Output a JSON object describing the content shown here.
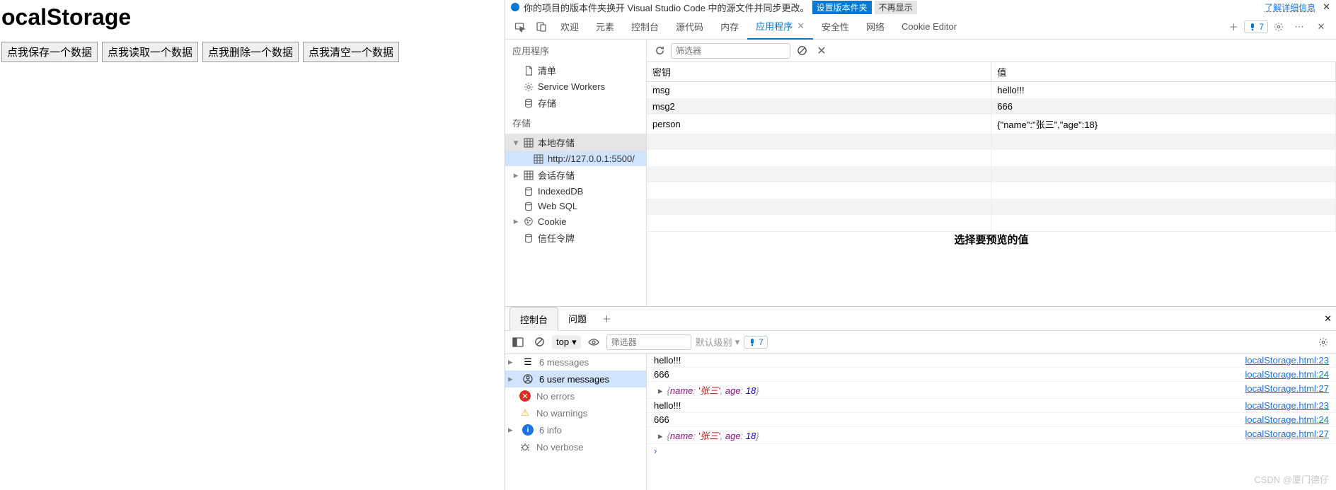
{
  "page": {
    "title": "ocalStorage",
    "buttons": [
      "点我保存一个数据",
      "点我读取一个数据",
      "点我删除一个数据",
      "点我清空一个数据"
    ]
  },
  "topBar": {
    "cutText": "你的项目的版本件夹换开 Visual Studio Code 中的源文件并同步更改。",
    "blueBtn": "设置版本件夹",
    "grayBtn": "不再显示",
    "link": "了解详细信息"
  },
  "devTabs": {
    "items": [
      "欢迎",
      "元素",
      "控制台",
      "源代码",
      "内存",
      "应用程序",
      "安全性",
      "网络",
      "Cookie Editor"
    ],
    "activeIndex": 5,
    "issueCount": "7"
  },
  "appSidebar": {
    "header": "应用程序",
    "appItems": [
      "清单",
      "Service Workers",
      "存储"
    ],
    "storageHeader": "存储",
    "storageTree": {
      "local": "本地存储",
      "localChild": "http://127.0.0.1:5500/",
      "session": "会话存储",
      "indexed": "IndexedDB",
      "websql": "Web SQL",
      "cookie": "Cookie",
      "trust": "信任令牌"
    }
  },
  "storagePanel": {
    "filterPlaceholder": "筛选器",
    "columns": [
      "密钥",
      "值"
    ],
    "rows": [
      {
        "key": "msg",
        "val": "hello!!!"
      },
      {
        "key": "msg2",
        "val": "666"
      },
      {
        "key": "person",
        "val": "{\"name\":\"张三\",\"age\":18}"
      }
    ],
    "selectHint": "选择要预览的值"
  },
  "consoleTabs": {
    "items": [
      "控制台",
      "问题"
    ],
    "activeIndex": 0
  },
  "consoleToolbar": {
    "context": "top",
    "filterPlaceholder": "筛选器",
    "level": "默认级别",
    "issueCount": "7"
  },
  "consoleSidebar": {
    "messages": "6 messages",
    "userMessages": "6 user messages",
    "errors": "No errors",
    "warnings": "No warnings",
    "info": "6 info",
    "verbose": "No verbose"
  },
  "consoleOutput": [
    {
      "type": "text",
      "msg": "hello!!!",
      "src": "localStorage.html:23"
    },
    {
      "type": "text",
      "msg": "666",
      "src": "localStorage.html:24"
    },
    {
      "type": "obj",
      "name": "name",
      "str": "'张三'",
      "age": "age",
      "num": "18",
      "src": "localStorage.html:27"
    },
    {
      "type": "text",
      "msg": "hello!!!",
      "src": "localStorage.html:23"
    },
    {
      "type": "text",
      "msg": "666",
      "src": "localStorage.html:24"
    },
    {
      "type": "obj",
      "name": "name",
      "str": "'张三'",
      "age": "age",
      "num": "18",
      "src": "localStorage.html:27"
    }
  ],
  "watermark": "CSDN @厦门德仔"
}
